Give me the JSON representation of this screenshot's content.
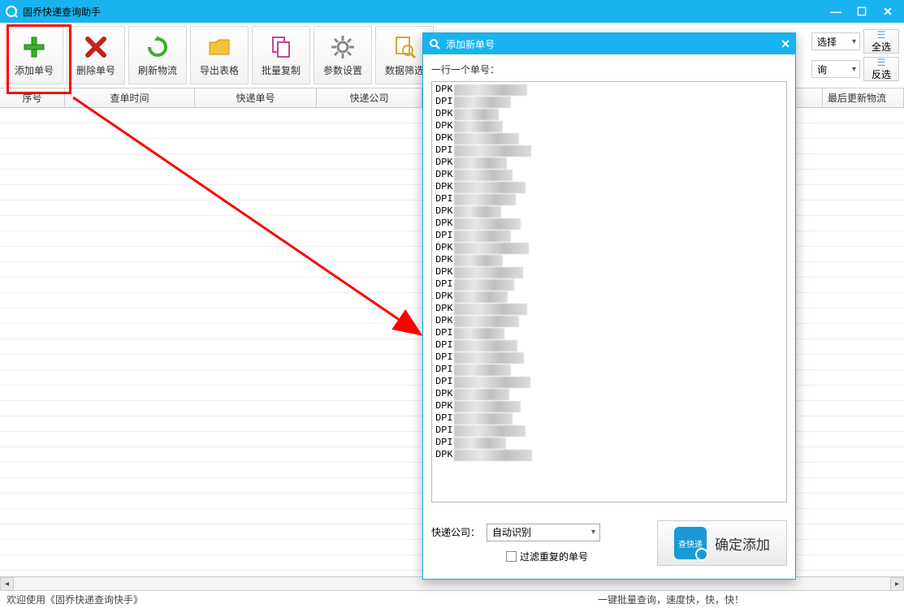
{
  "window": {
    "title": "固乔快递查询助手"
  },
  "toolbar": {
    "add": "添加单号",
    "delete": "删除单号",
    "refresh": "刷新物流",
    "export": "导出表格",
    "copy": "批量复制",
    "settings": "参数设置",
    "filter": "数据筛选"
  },
  "rightTools": {
    "selectLabel": "选择",
    "queryLabel": "询",
    "selectAll": "全选",
    "invert": "反选"
  },
  "columns": {
    "seq": "序号",
    "time": "查单时间",
    "number": "快递单号",
    "company": "快递公司",
    "lastUpdate": "最后更新物流"
  },
  "status": {
    "left": "欢迎使用《固乔快递查询快手》",
    "right": "一键批量查询，速度快，快，快！"
  },
  "modal": {
    "title": "添加新单号",
    "hint": "一行一个单号：",
    "companyLabel": "快递公司：",
    "companySelect": "自动识别",
    "dedupe": "过滤重复的单号",
    "confirm": "确定添加",
    "iconText": "查快递",
    "trackingPrefix": "DP",
    "trackingLines": 31
  }
}
